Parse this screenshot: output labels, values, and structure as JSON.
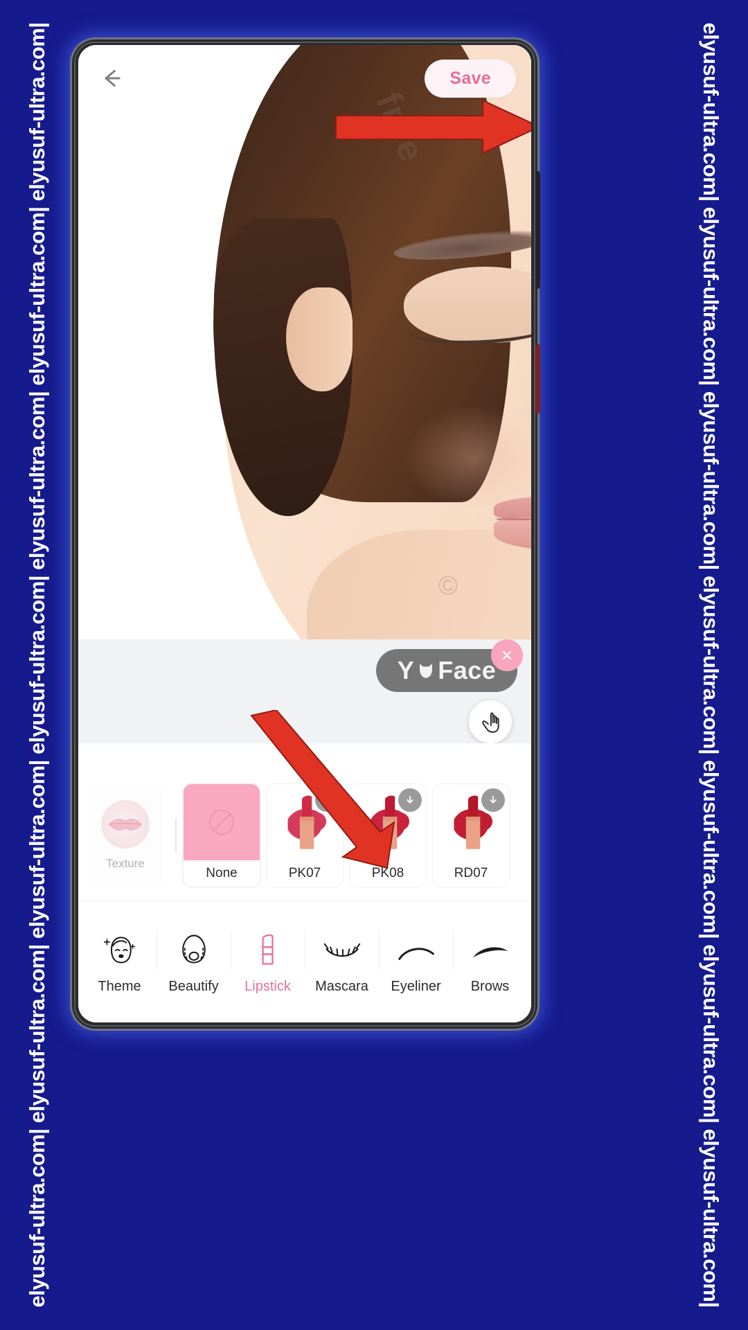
{
  "watermark": {
    "text": "elyusuf-ultra.com| elyusuf-ultra.com| elyusuf-ultra.com| elyusuf-ultra.com| elyusuf-ultra.com| elyusuf-ultra.com| elyusuf-ultra.com|",
    "background_color": "#151b8d",
    "text_color": "#ffffff"
  },
  "app": {
    "name": "YuFace",
    "accent_color": "#e86f95",
    "topbar": {
      "back_icon": "arrow-left-icon",
      "save_label": "Save",
      "save_text_color": "#e96d93",
      "save_bg_color": "#fdf3f6"
    },
    "photo": {
      "stock_watermark": "free",
      "stock_watermark_2": "©"
    },
    "banner": {
      "brand_text_before": "Y",
      "brand_icon": "cat-face-icon",
      "brand_text_after": "Face",
      "badge_bg_color": "#767676",
      "close_icon": "close-icon",
      "close_bg_color": "#f9a5bd",
      "hand_icon": "tap-hand-icon"
    },
    "swatches": {
      "texture": {
        "label": "Texture",
        "icon": "lips-icon"
      },
      "items": [
        {
          "label": "None",
          "type": "none",
          "color": "#f8a8c0",
          "downloadable": false,
          "selected": true
        },
        {
          "label": "PK07",
          "type": "lipstick",
          "color": "#d43b5a",
          "downloadable": true,
          "selected": false
        },
        {
          "label": "PK08",
          "type": "lipstick",
          "color": "#c8243f",
          "downloadable": true,
          "selected": false
        },
        {
          "label": "RD07",
          "type": "lipstick",
          "color": "#c01f33",
          "downloadable": true,
          "selected": false
        }
      ]
    },
    "nav": [
      {
        "label": "Theme",
        "icon": "theme-face-icon",
        "active": false
      },
      {
        "label": "Beautify",
        "icon": "beautify-icon",
        "active": false
      },
      {
        "label": "Lipstick",
        "icon": "lipstick-icon",
        "active": true
      },
      {
        "label": "Mascara",
        "icon": "mascara-icon",
        "active": false
      },
      {
        "label": "Eyeliner",
        "icon": "eyeliner-icon",
        "active": false
      },
      {
        "label": "Brows",
        "icon": "brows-icon",
        "active": false
      }
    ],
    "annotations": [
      {
        "name": "arrow-to-save",
        "icon": "red-arrow-right-icon"
      },
      {
        "name": "arrow-to-swatches",
        "icon": "red-arrow-down-right-icon"
      }
    ]
  }
}
